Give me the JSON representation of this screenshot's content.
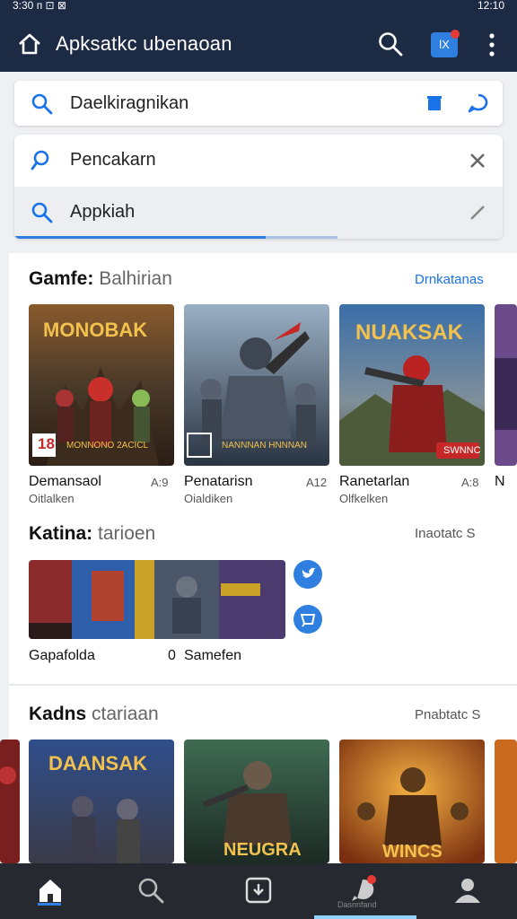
{
  "status": {
    "left": "3:30 п  ⊡ ⊠",
    "right": "12:10"
  },
  "appbar": {
    "title": "Apksatkc ubenaoan",
    "badge_text": "lX"
  },
  "search": {
    "main_text": "Daelkiragnikan",
    "suggestions": [
      {
        "text": "Pencakarn"
      },
      {
        "text": "Appkiah"
      }
    ]
  },
  "sections": [
    {
      "title": "Gamfe:",
      "subtitle": "Balhirian",
      "link": "Drnkatanas",
      "tiles": [
        {
          "name": "Demansaol",
          "sub": "Oitlalken",
          "rating": "A:9",
          "art": "MONOBAK",
          "age": "18",
          "tag": "MONNONO 2ACICL"
        },
        {
          "name": "Penatarisn",
          "sub": "Oialdiken",
          "rating": "A12",
          "art": "",
          "age": "",
          "tag": "NANNNAN HNNNAN"
        },
        {
          "name": "Ranetarlan",
          "sub": "Olfkelken",
          "rating": "A:8",
          "art": "NUAKSAK",
          "age": "",
          "tag": "SWNNC"
        },
        {
          "name": "N",
          "sub": "",
          "rating": "",
          "art": "",
          "age": "",
          "tag": ""
        }
      ]
    },
    {
      "title": "Katina:",
      "subtitle": "tarioen",
      "link": "Inaotatc S",
      "banner": {
        "left_label": "Gapafolda",
        "right_label": "Samefen",
        "count": "0"
      }
    },
    {
      "title": "Kadns",
      "subtitle": "ctariaan",
      "link": "Pnabtatc S",
      "tiles": [
        {
          "art": "DAANSAK"
        },
        {
          "art": "NEUGRA"
        },
        {
          "art": "WINCS"
        }
      ]
    }
  ],
  "nav": {
    "active_label": "Dasnnfand"
  },
  "colors": {
    "appbar": "#1d2a44",
    "accent": "#2f7fe0",
    "nav": "#262a30",
    "link": "#1a73e8"
  }
}
